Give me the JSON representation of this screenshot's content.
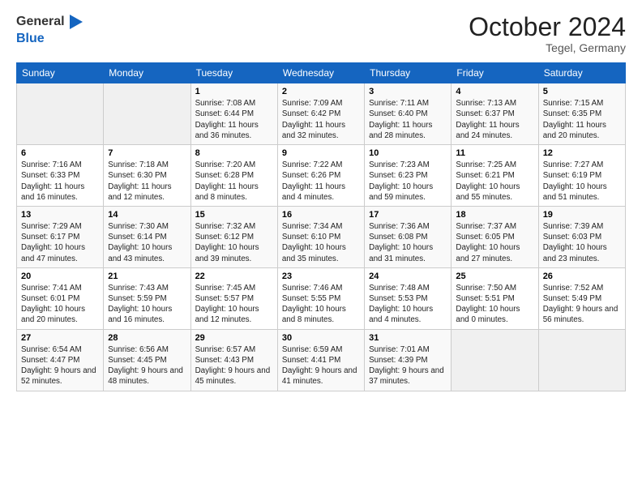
{
  "header": {
    "logo_general": "General",
    "logo_blue": "Blue",
    "month_title": "October 2024",
    "location": "Tegel, Germany"
  },
  "days_of_week": [
    "Sunday",
    "Monday",
    "Tuesday",
    "Wednesday",
    "Thursday",
    "Friday",
    "Saturday"
  ],
  "weeks": [
    [
      {
        "day": "",
        "info": ""
      },
      {
        "day": "",
        "info": ""
      },
      {
        "day": "1",
        "info": "Sunrise: 7:08 AM\nSunset: 6:44 PM\nDaylight: 11 hours and 36 minutes."
      },
      {
        "day": "2",
        "info": "Sunrise: 7:09 AM\nSunset: 6:42 PM\nDaylight: 11 hours and 32 minutes."
      },
      {
        "day": "3",
        "info": "Sunrise: 7:11 AM\nSunset: 6:40 PM\nDaylight: 11 hours and 28 minutes."
      },
      {
        "day": "4",
        "info": "Sunrise: 7:13 AM\nSunset: 6:37 PM\nDaylight: 11 hours and 24 minutes."
      },
      {
        "day": "5",
        "info": "Sunrise: 7:15 AM\nSunset: 6:35 PM\nDaylight: 11 hours and 20 minutes."
      }
    ],
    [
      {
        "day": "6",
        "info": "Sunrise: 7:16 AM\nSunset: 6:33 PM\nDaylight: 11 hours and 16 minutes."
      },
      {
        "day": "7",
        "info": "Sunrise: 7:18 AM\nSunset: 6:30 PM\nDaylight: 11 hours and 12 minutes."
      },
      {
        "day": "8",
        "info": "Sunrise: 7:20 AM\nSunset: 6:28 PM\nDaylight: 11 hours and 8 minutes."
      },
      {
        "day": "9",
        "info": "Sunrise: 7:22 AM\nSunset: 6:26 PM\nDaylight: 11 hours and 4 minutes."
      },
      {
        "day": "10",
        "info": "Sunrise: 7:23 AM\nSunset: 6:23 PM\nDaylight: 10 hours and 59 minutes."
      },
      {
        "day": "11",
        "info": "Sunrise: 7:25 AM\nSunset: 6:21 PM\nDaylight: 10 hours and 55 minutes."
      },
      {
        "day": "12",
        "info": "Sunrise: 7:27 AM\nSunset: 6:19 PM\nDaylight: 10 hours and 51 minutes."
      }
    ],
    [
      {
        "day": "13",
        "info": "Sunrise: 7:29 AM\nSunset: 6:17 PM\nDaylight: 10 hours and 47 minutes."
      },
      {
        "day": "14",
        "info": "Sunrise: 7:30 AM\nSunset: 6:14 PM\nDaylight: 10 hours and 43 minutes."
      },
      {
        "day": "15",
        "info": "Sunrise: 7:32 AM\nSunset: 6:12 PM\nDaylight: 10 hours and 39 minutes."
      },
      {
        "day": "16",
        "info": "Sunrise: 7:34 AM\nSunset: 6:10 PM\nDaylight: 10 hours and 35 minutes."
      },
      {
        "day": "17",
        "info": "Sunrise: 7:36 AM\nSunset: 6:08 PM\nDaylight: 10 hours and 31 minutes."
      },
      {
        "day": "18",
        "info": "Sunrise: 7:37 AM\nSunset: 6:05 PM\nDaylight: 10 hours and 27 minutes."
      },
      {
        "day": "19",
        "info": "Sunrise: 7:39 AM\nSunset: 6:03 PM\nDaylight: 10 hours and 23 minutes."
      }
    ],
    [
      {
        "day": "20",
        "info": "Sunrise: 7:41 AM\nSunset: 6:01 PM\nDaylight: 10 hours and 20 minutes."
      },
      {
        "day": "21",
        "info": "Sunrise: 7:43 AM\nSunset: 5:59 PM\nDaylight: 10 hours and 16 minutes."
      },
      {
        "day": "22",
        "info": "Sunrise: 7:45 AM\nSunset: 5:57 PM\nDaylight: 10 hours and 12 minutes."
      },
      {
        "day": "23",
        "info": "Sunrise: 7:46 AM\nSunset: 5:55 PM\nDaylight: 10 hours and 8 minutes."
      },
      {
        "day": "24",
        "info": "Sunrise: 7:48 AM\nSunset: 5:53 PM\nDaylight: 10 hours and 4 minutes."
      },
      {
        "day": "25",
        "info": "Sunrise: 7:50 AM\nSunset: 5:51 PM\nDaylight: 10 hours and 0 minutes."
      },
      {
        "day": "26",
        "info": "Sunrise: 7:52 AM\nSunset: 5:49 PM\nDaylight: 9 hours and 56 minutes."
      }
    ],
    [
      {
        "day": "27",
        "info": "Sunrise: 6:54 AM\nSunset: 4:47 PM\nDaylight: 9 hours and 52 minutes."
      },
      {
        "day": "28",
        "info": "Sunrise: 6:56 AM\nSunset: 4:45 PM\nDaylight: 9 hours and 48 minutes."
      },
      {
        "day": "29",
        "info": "Sunrise: 6:57 AM\nSunset: 4:43 PM\nDaylight: 9 hours and 45 minutes."
      },
      {
        "day": "30",
        "info": "Sunrise: 6:59 AM\nSunset: 4:41 PM\nDaylight: 9 hours and 41 minutes."
      },
      {
        "day": "31",
        "info": "Sunrise: 7:01 AM\nSunset: 4:39 PM\nDaylight: 9 hours and 37 minutes."
      },
      {
        "day": "",
        "info": ""
      },
      {
        "day": "",
        "info": ""
      }
    ]
  ]
}
